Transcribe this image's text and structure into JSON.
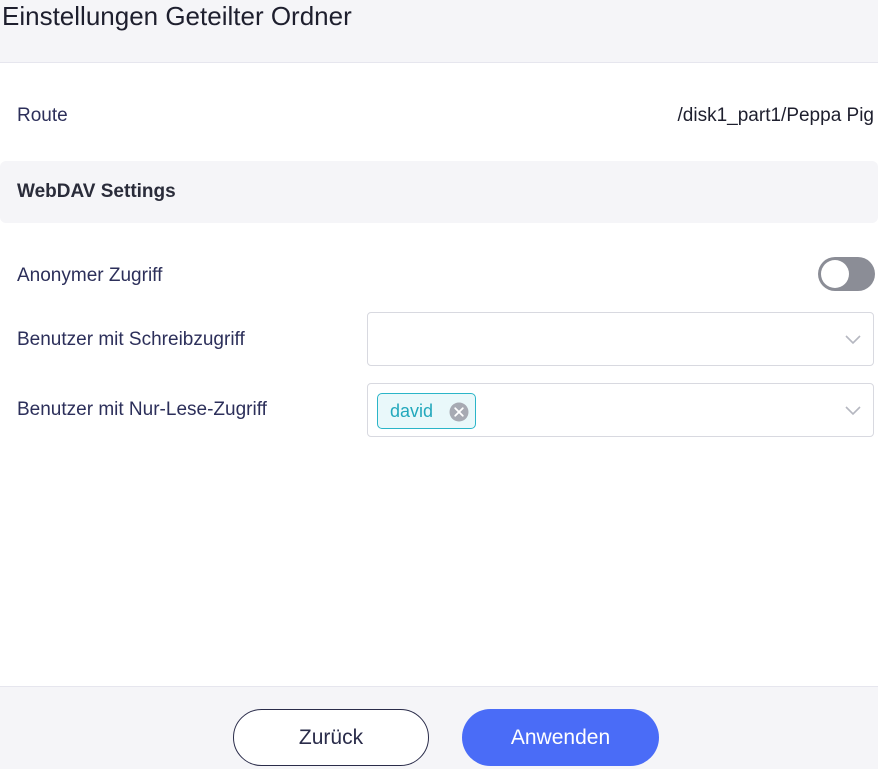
{
  "header": {
    "title": "Einstellungen Geteilter Ordner"
  },
  "route": {
    "label": "Route",
    "value": "/disk1_part1/Peppa Pig"
  },
  "webdav": {
    "section_title": "WebDAV Settings",
    "anonymous": {
      "label": "Anonymer Zugriff",
      "enabled": false
    },
    "write_users": {
      "label": "Benutzer mit Schreibzugriff",
      "selected": []
    },
    "readonly_users": {
      "label": "Benutzer mit Nur-Lese-Zugriff",
      "selected": [
        "david"
      ]
    }
  },
  "icons": {
    "dropdown": "chevron-down-icon",
    "tag_remove": "close-circle-icon"
  },
  "colors": {
    "primary": "#4a6cf7",
    "tag_accent": "#2bb5c8",
    "toggle_off": "#8b8d96",
    "label_text": "#2c2f5a"
  },
  "footer": {
    "back_label": "Zurück",
    "apply_label": "Anwenden"
  }
}
